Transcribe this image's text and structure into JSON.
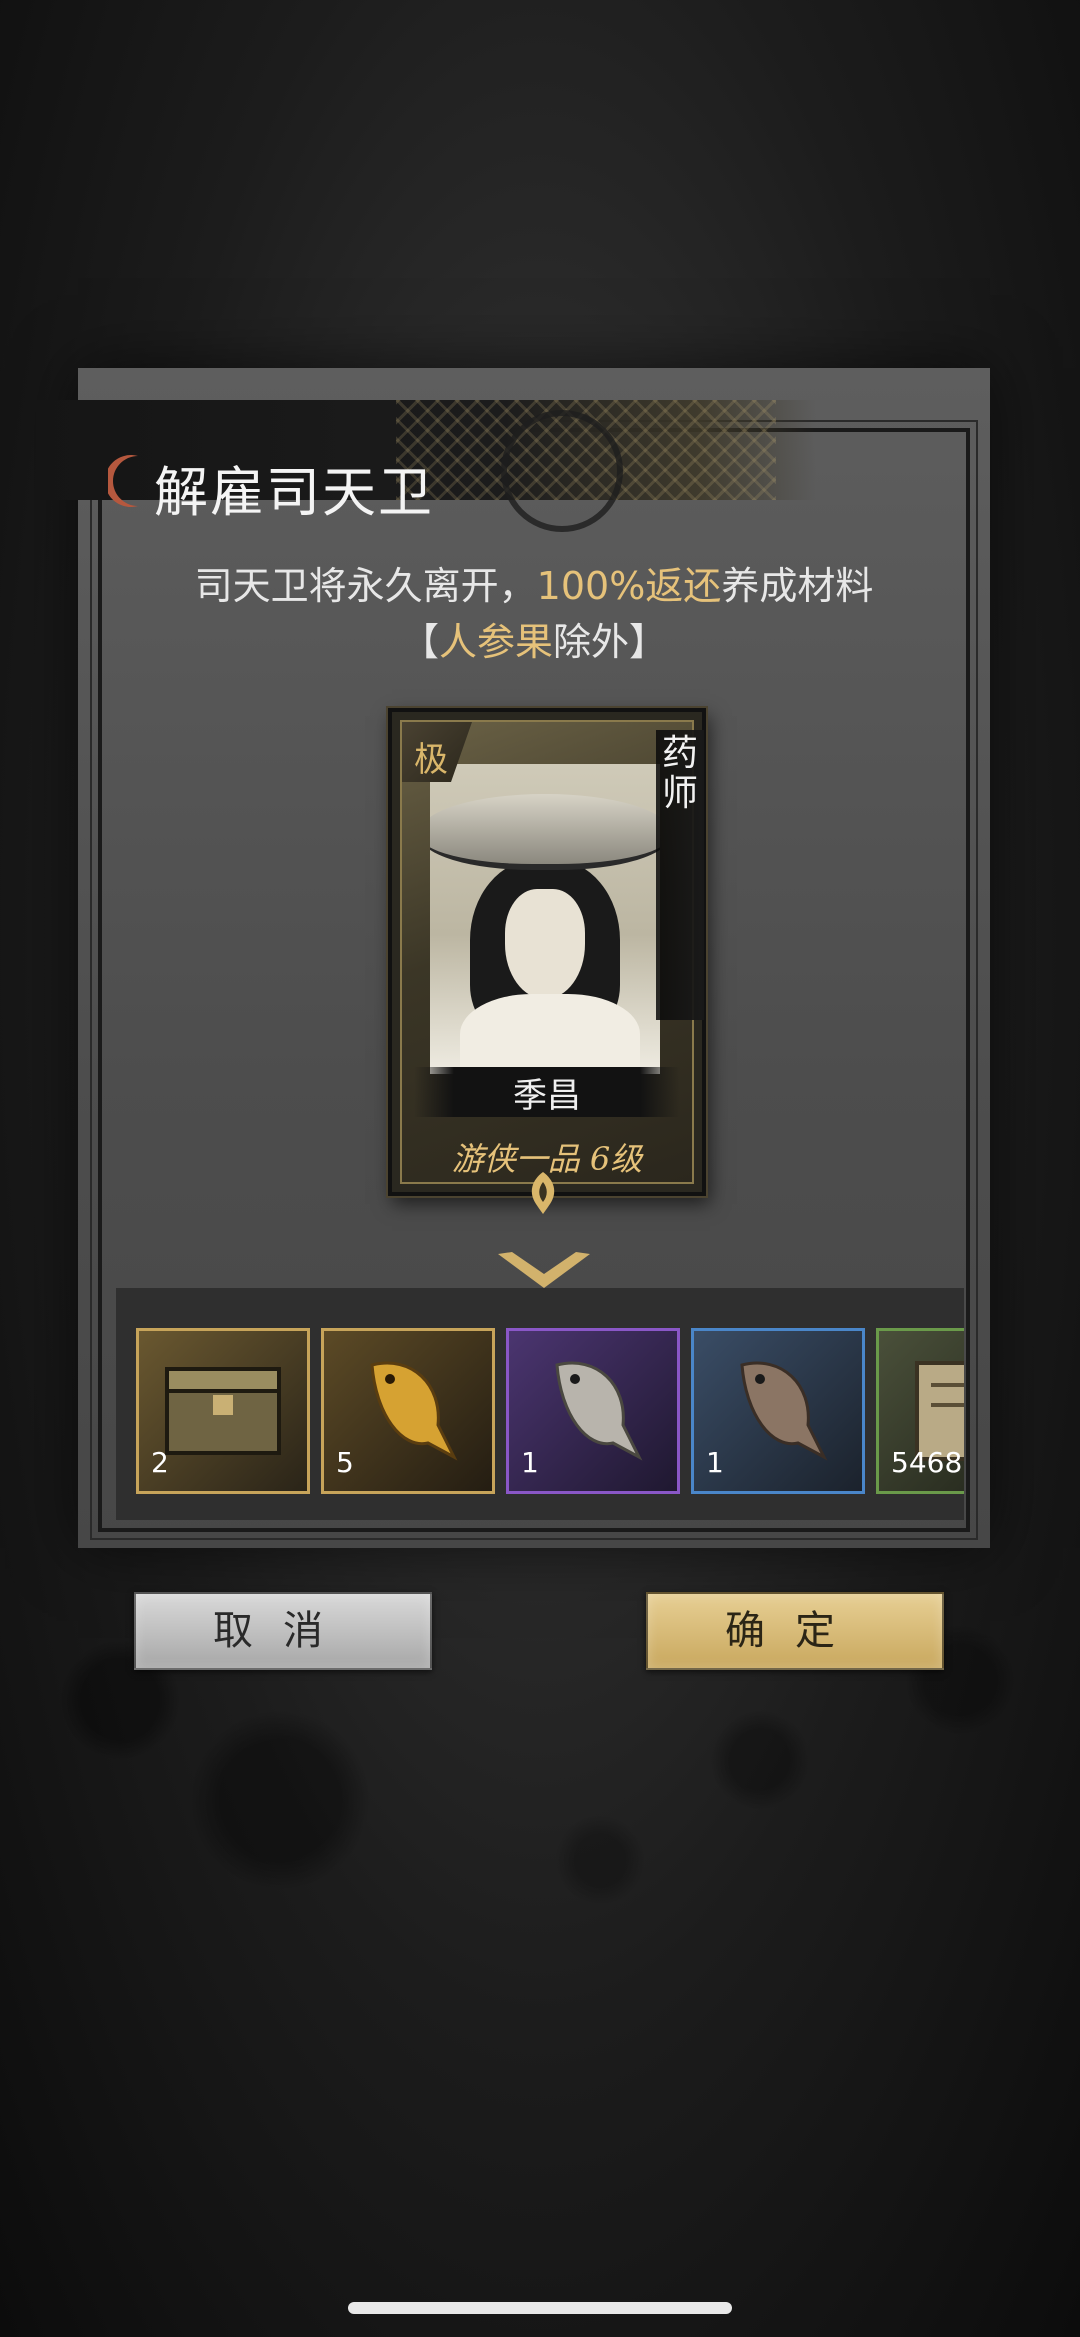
{
  "dialog": {
    "title": "解雇司天卫",
    "notice_part1": "司天卫将永久离开，",
    "notice_highlight": "100%返还",
    "notice_part2": "养成材料",
    "exception_open": "【",
    "exception_item": "人参果",
    "exception_close": "除外】"
  },
  "card": {
    "rank": "极",
    "class": "药师",
    "name": "季昌",
    "level": "游侠一品 6级"
  },
  "items": [
    {
      "icon": "treasure-chest-icon",
      "count": "2",
      "border": "#c7a45a",
      "bg": "#5a4b2c"
    },
    {
      "icon": "gold-fish-icon",
      "count": "5",
      "border": "#c7a45a",
      "bg": "#4d3d22"
    },
    {
      "icon": "silver-fish-icon",
      "count": "1",
      "border": "#8a57c7",
      "bg": "#3f2e5a"
    },
    {
      "icon": "bronze-fish-icon",
      "count": "1",
      "border": "#4a86c9",
      "bg": "#2f3d4f"
    },
    {
      "icon": "book-icon",
      "count": "5468",
      "border": "#6a9a4a",
      "bg": "#3a3f2c"
    }
  ],
  "buttons": {
    "cancel": "取消",
    "confirm": "确定"
  }
}
